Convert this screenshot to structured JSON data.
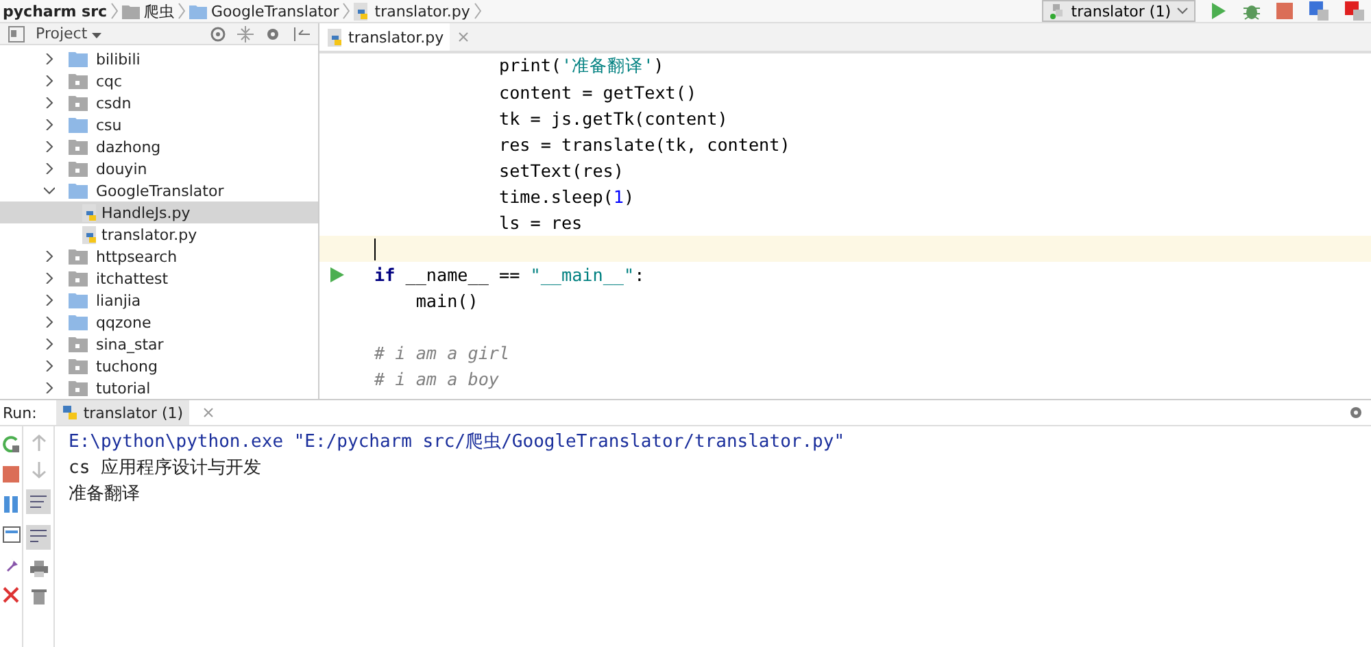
{
  "breadcrumb": [
    {
      "label": "pycharm src",
      "kind": "root"
    },
    {
      "label": "爬虫",
      "kind": "folder"
    },
    {
      "label": "GoogleTranslator",
      "kind": "package"
    },
    {
      "label": "translator.py",
      "kind": "file"
    }
  ],
  "toolbar": {
    "run_config": "translator (1)"
  },
  "project": {
    "title": "Project",
    "items": [
      {
        "label": "bilibili",
        "kind": "package",
        "expanded": false,
        "selected": false
      },
      {
        "label": "cqc",
        "kind": "folder",
        "expanded": false,
        "selected": false
      },
      {
        "label": "csdn",
        "kind": "folder",
        "expanded": false,
        "selected": false
      },
      {
        "label": "csu",
        "kind": "package",
        "expanded": false,
        "selected": false
      },
      {
        "label": "dazhong",
        "kind": "folder",
        "expanded": false,
        "selected": false
      },
      {
        "label": "douyin",
        "kind": "folder",
        "expanded": false,
        "selected": false
      },
      {
        "label": "GoogleTranslator",
        "kind": "package",
        "expanded": true,
        "selected": false,
        "children": [
          {
            "label": "HandleJs.py",
            "kind": "file",
            "selected": true
          },
          {
            "label": "translator.py",
            "kind": "file",
            "selected": false
          }
        ]
      },
      {
        "label": "httpsearch",
        "kind": "folder",
        "expanded": false,
        "selected": false
      },
      {
        "label": "itchattest",
        "kind": "folder",
        "expanded": false,
        "selected": false
      },
      {
        "label": "lianjia",
        "kind": "package",
        "expanded": false,
        "selected": false
      },
      {
        "label": "qqzone",
        "kind": "package",
        "expanded": false,
        "selected": false
      },
      {
        "label": "sina_star",
        "kind": "folder",
        "expanded": false,
        "selected": false
      },
      {
        "label": "tuchong",
        "kind": "folder",
        "expanded": false,
        "selected": false
      },
      {
        "label": "tutorial",
        "kind": "folder",
        "expanded": false,
        "selected": false
      }
    ]
  },
  "editor": {
    "tab": "translator.py",
    "lines": [
      {
        "segments": [
          {
            "text": "            print(",
            "kind": "plain"
          },
          {
            "text": "'准备翻译'",
            "kind": "string"
          },
          {
            "text": ")",
            "kind": "plain"
          }
        ]
      },
      {
        "segments": [
          {
            "text": "            content = getText()",
            "kind": "plain"
          }
        ]
      },
      {
        "segments": [
          {
            "text": "            tk = js.getTk(content)",
            "kind": "plain"
          }
        ]
      },
      {
        "segments": [
          {
            "text": "            res = translate(tk, content)",
            "kind": "plain"
          }
        ]
      },
      {
        "segments": [
          {
            "text": "            setText(res)",
            "kind": "plain"
          }
        ]
      },
      {
        "segments": [
          {
            "text": "            time.sleep(",
            "kind": "plain"
          },
          {
            "text": "1",
            "kind": "number"
          },
          {
            "text": ")",
            "kind": "plain"
          }
        ]
      },
      {
        "segments": [
          {
            "text": "            ls = res",
            "kind": "plain"
          }
        ]
      },
      {
        "current": true
      },
      {
        "runnable": true,
        "segments": [
          {
            "text": "if",
            "kind": "keyword"
          },
          {
            "text": " __name__ == ",
            "kind": "plain"
          },
          {
            "text": "\"__main__\"",
            "kind": "string"
          },
          {
            "text": ":",
            "kind": "plain"
          }
        ]
      },
      {
        "segments": [
          {
            "text": "    main()",
            "kind": "plain"
          }
        ]
      },
      {
        "kind": "blank"
      },
      {
        "segments": [
          {
            "text": "# i am a girl",
            "kind": "comment"
          }
        ]
      },
      {
        "segments": [
          {
            "text": "# i am a boy",
            "kind": "comment"
          }
        ]
      }
    ]
  },
  "run": {
    "label": "Run:",
    "tab": "translator (1)",
    "output": [
      {
        "text": "E:\\python\\python.exe \"E:/pycharm src/爬虫/GoogleTranslator/translator.py\"",
        "kind": "command"
      },
      {
        "text": "cs 应用程序设计与开发",
        "kind": "stdout"
      },
      {
        "text": "准备翻译",
        "kind": "stdout"
      }
    ]
  }
}
